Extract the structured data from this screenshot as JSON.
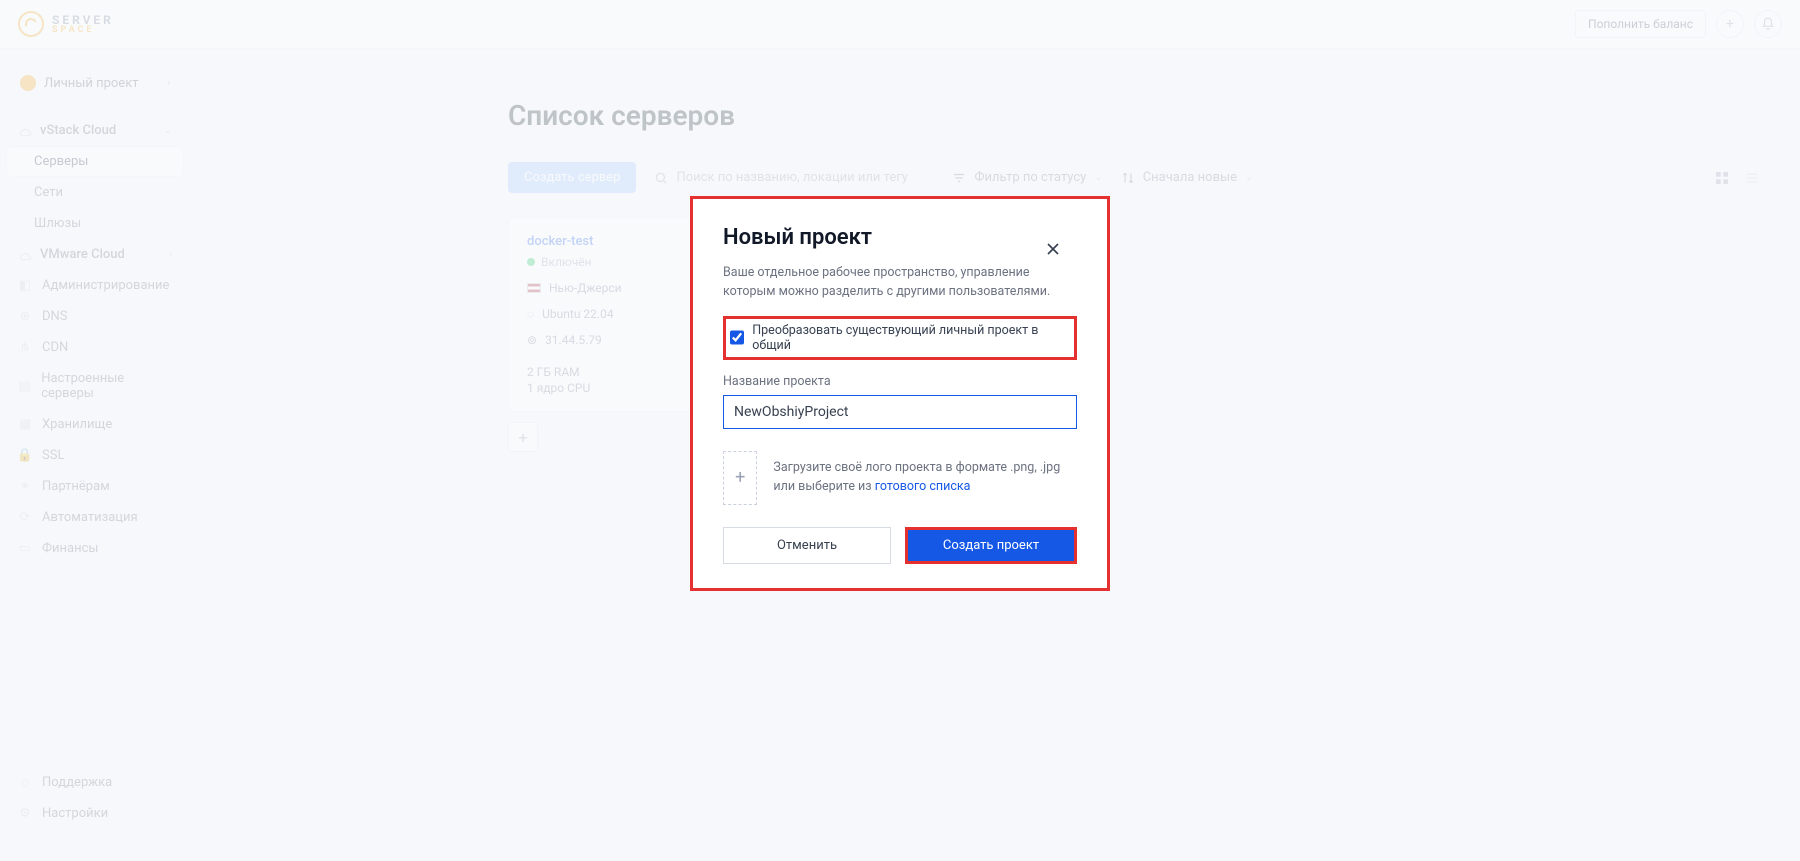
{
  "header": {
    "logo_top": "SERVER",
    "logo_bottom": "SPACE",
    "balance_btn": "Пополнить баланс"
  },
  "sidebar": {
    "project_pill": "Личный проект",
    "groups": [
      {
        "name": "vStack Cloud",
        "open": true,
        "items": [
          "Серверы",
          "Сети",
          "Шлюзы"
        ],
        "active_index": 0
      },
      {
        "name": "VMware Cloud",
        "open": false,
        "items": []
      }
    ],
    "items": [
      "Администрирование",
      "DNS",
      "CDN",
      "Настроенные серверы",
      "Хранилище",
      "SSL",
      "Партнёрам",
      "Автоматизация",
      "Финансы"
    ],
    "bottom": [
      "Поддержка",
      "Настройки"
    ]
  },
  "page": {
    "title": "Список серверов",
    "create_btn": "Создать сервер",
    "search_placeholder": "Поиск по названию, локации или тегу",
    "filter_label": "Фильтр по статусу",
    "sort_label": "Сначала новые"
  },
  "server_card": {
    "name": "docker-test",
    "status": "Включён",
    "location": "Нью-Джерси",
    "os": "Ubuntu 22.04",
    "ip": "31.44.5.79",
    "ram": "2 ГБ RAM",
    "cpu": "1 ядро CPU"
  },
  "modal": {
    "title": "Новый проект",
    "description": "Ваше отдельное рабочее пространство, управление которым можно разделить с другими пользователями.",
    "checkbox_label": "Преобразовать существующий личный проект в общий",
    "checkbox_checked": "true",
    "field_label": "Название проекта",
    "field_value": "NewObshiyProject",
    "upload_text_pre": "Загрузите своё лого проекта в формате .png, .jpg или выберите из ",
    "upload_link": "готового списка",
    "cancel": "Отменить",
    "create": "Создать проект"
  }
}
